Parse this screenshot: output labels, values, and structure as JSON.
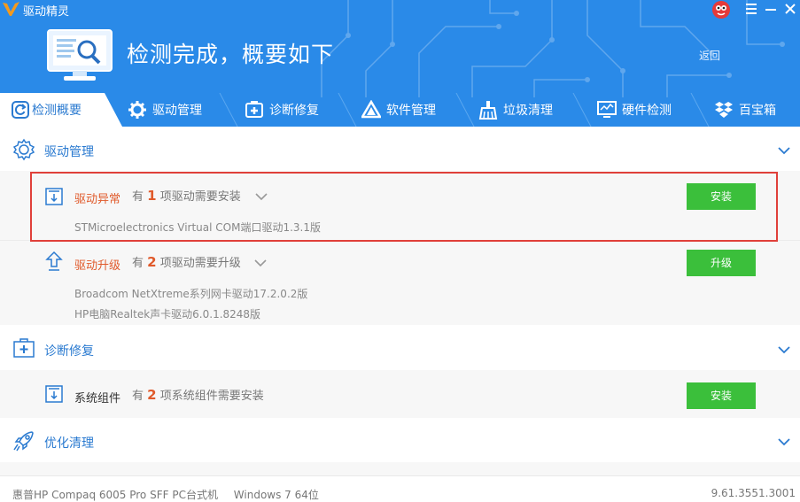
{
  "window": {
    "title": "驱动精灵",
    "minimize_icon": "menu-icon",
    "controls": [
      "menu-icon",
      "minimize-icon",
      "close-icon"
    ]
  },
  "header": {
    "headline": "检测完成，概要如下",
    "back_label": "返回"
  },
  "tabs": [
    {
      "label": "检测概要",
      "icon": "refresh-icon",
      "active": true
    },
    {
      "label": "驱动管理",
      "icon": "gear-icon",
      "active": false
    },
    {
      "label": "诊断修复",
      "icon": "medkit-icon",
      "active": false
    },
    {
      "label": "软件管理",
      "icon": "triangle-icon",
      "active": false
    },
    {
      "label": "垃圾清理",
      "icon": "broom-icon",
      "active": false
    },
    {
      "label": "硬件检测",
      "icon": "monitor-icon",
      "active": false
    },
    {
      "label": "百宝箱",
      "icon": "dropbox-icon",
      "active": false
    }
  ],
  "sections": {
    "driver": {
      "title": "驱动管理",
      "anomaly": {
        "title": "驱动异常",
        "desc_pre": "有",
        "count": "1",
        "desc_post": "项驱动需要安装",
        "button": "安装",
        "items": [
          "STMicroelectronics Virtual COM端口驱动1.3.1版"
        ]
      },
      "upgrade": {
        "title": "驱动升级",
        "desc_pre": "有",
        "count": "2",
        "desc_post": "项驱动需要升级",
        "button": "升级",
        "items": [
          "Broadcom NetXtreme系列网卡驱动17.2.0.2版",
          "HP电脑Realtek声卡驱动6.0.1.8248版"
        ]
      }
    },
    "diagnose": {
      "title": "诊断修复",
      "component": {
        "title": "系统组件",
        "desc_pre": "有",
        "count": "2",
        "desc_post": "项系统组件需要安装",
        "button": "安装"
      }
    },
    "optimize": {
      "title": "优化清理"
    }
  },
  "footer": {
    "machine": "惠普HP Compaq 6005 Pro SFF PC台式机",
    "os": "Windows 7 64位",
    "version": "9.61.3551.3001"
  },
  "colors": {
    "header_blue": "#2a8ae8",
    "accent_red": "#e05a2b",
    "button_green": "#3bbf3b",
    "link_blue": "#2a7ad0"
  }
}
